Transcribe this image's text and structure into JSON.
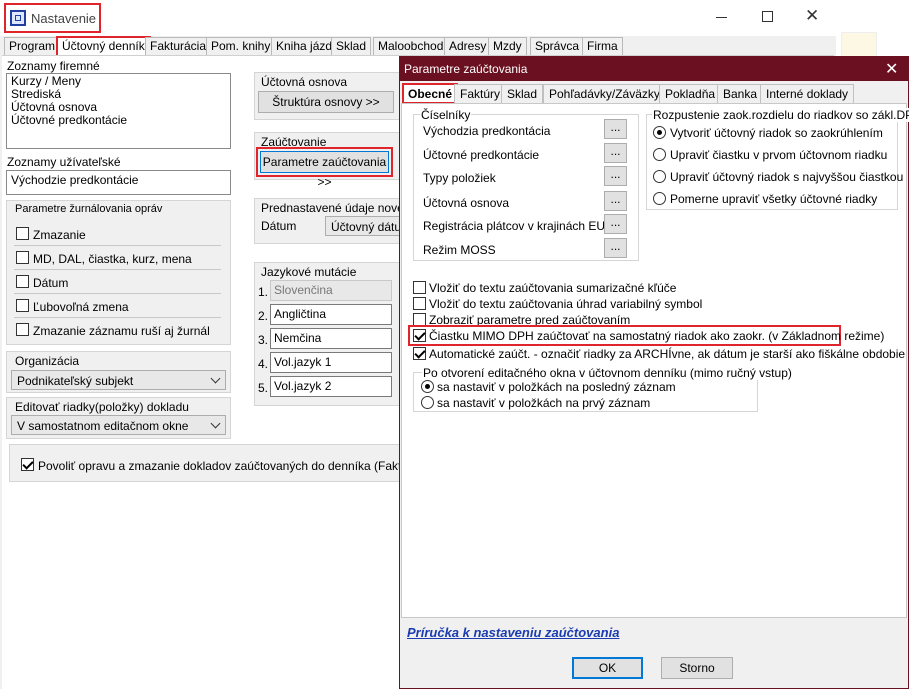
{
  "main_window": {
    "title": "Nastavenie",
    "tabs": [
      "Program",
      "Účtovný denník",
      "Fakturácia",
      "Pom. knihy",
      "Kniha jázd",
      "Sklad",
      "Maloobchod",
      "Adresy",
      "Mzdy",
      "Správca",
      "Firma"
    ],
    "company_lists_label": "Zoznamy firemné",
    "company_lists": [
      "Kurzy / Meny",
      "Strediská",
      "Účtovná osnova",
      "Účtovné predkontácie"
    ],
    "user_lists_label": "Zoznamy užívateľské",
    "user_lists": [
      "Východzie predkontácie"
    ],
    "journal_group_label": "Parametre žurnálovania opráv",
    "journal_options": [
      "Zmazanie",
      "MD, DAL, čiastka, kurz, mena",
      "Dátum",
      "Ľubovoľná zmena",
      "Zmazanie záznamu ruší aj žurnál"
    ],
    "organization_label": "Organizácia",
    "organization_value": "Podnikateľský subjekt",
    "edit_rows_label": "Editovať riadky(položky) dokladu",
    "edit_rows_value": "V samostatnom editačnom okne",
    "chart_label": "Účtovná osnova",
    "chart_button": "Štruktúra osnovy >>",
    "posting_label": "Zaúčtovanie",
    "posting_button": "Parametre zaúčtovania >>",
    "preset_label": "Prednastavené údaje nového",
    "date_label": "Dátum",
    "date_value": "Účtovný dátum",
    "lang_label": "Jazykové mutácie",
    "languages": [
      {
        "num": "1.",
        "name": "Slovenčina"
      },
      {
        "num": "2.",
        "name": "Angličtina"
      },
      {
        "num": "3.",
        "name": "Nemčina"
      },
      {
        "num": "4.",
        "name": "Vol.jazyk 1"
      },
      {
        "num": "5.",
        "name": "Vol.jazyk 2"
      }
    ],
    "allow_edit_text": "Povoliť opravu a zmazanie dokladov zaúčtovaných do denníka (Faktúry, Poh"
  },
  "dialog": {
    "title": "Parametre zaúčtovania",
    "tabs": [
      "Obecné",
      "Faktúry",
      "Sklad",
      "Pohľadávky/Záväzky",
      "Pokladňa",
      "Banka",
      "Interné doklady"
    ],
    "registers_label": "Číselníky",
    "registers": [
      "Východzia predkontácia",
      "Účtovné predkontácie",
      "Typy položiek",
      "Účtovná osnova",
      "Registrácia plátcov v krajinách EU",
      "Režim MOSS"
    ],
    "dots": "...",
    "vat_group_label": "Rozpustenie zaok.rozdielu do riadkov so zákl.DPH",
    "vat_options": [
      "Vytvoriť účtovný riadok so zaokrúhlením",
      "Upraviť čiastku v prvom účtovnom riadku",
      "Upraviť účtovný riadok s najvyššou čiastkou",
      "Pomerne upraviť všetky účtovné riadky"
    ],
    "checkboxes": [
      "Vložiť do textu zaúčtovania sumarizačné kľúče",
      "Vložiť do textu zaúčtovania úhrad variabilný symbol",
      "Zobraziť parametre pred zaúčtovaním",
      "Čiastku MIMO DPH zaúčtovať na samostatný riadok ako zaokr. (v Základnom režime)",
      "Automatické zaúčt. - označiť riadky za ARCHÍvne, ak dátum je starší ako fiškálne obdobie"
    ],
    "open_group_label": "Po otvorení editačného okna v účtovnom denníku (mimo ručný vstup)",
    "open_options": [
      "sa nastaviť v položkách na posledný záznam",
      "sa nastaviť v položkách na prvý záznam"
    ],
    "help_link": "Príručka k nastaveniu zaúčtovania",
    "ok": "OK",
    "cancel": "Storno"
  }
}
